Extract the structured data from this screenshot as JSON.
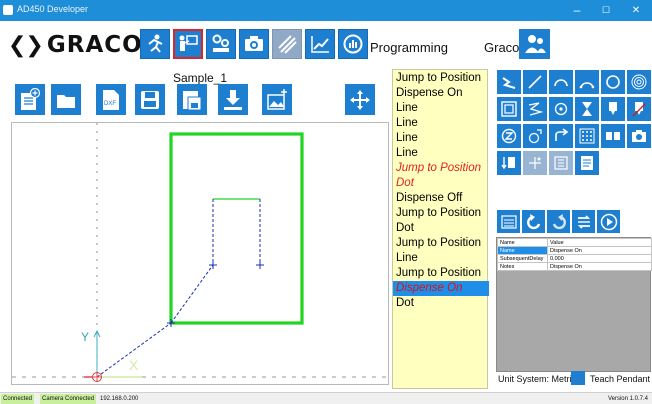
{
  "window": {
    "title": "AD450 Developer",
    "minimize": "–",
    "maximize": "☐",
    "close": "✕"
  },
  "header": {
    "logo_text": "GRACO",
    "mode": "Programming",
    "user": "Graco"
  },
  "file": {
    "name": "Sample_1",
    "dxf_label": "DXF"
  },
  "program_list": [
    {
      "label": "Jump to Position",
      "style": "normal"
    },
    {
      "label": "Dispense On",
      "style": "normal"
    },
    {
      "label": "Line",
      "style": "normal"
    },
    {
      "label": "Line",
      "style": "normal"
    },
    {
      "label": "Line",
      "style": "normal"
    },
    {
      "label": "Line",
      "style": "normal"
    },
    {
      "label": "Jump to Position",
      "style": "red"
    },
    {
      "label": "Dot",
      "style": "red"
    },
    {
      "label": "Dispense Off",
      "style": "normal"
    },
    {
      "label": "Jump to Position",
      "style": "normal"
    },
    {
      "label": "Dot",
      "style": "normal"
    },
    {
      "label": "Jump to Position",
      "style": "normal"
    },
    {
      "label": "Line",
      "style": "normal"
    },
    {
      "label": "Jump to Position",
      "style": "normal"
    },
    {
      "label": "Dispense On",
      "style": "selected"
    },
    {
      "label": "Dot",
      "style": "normal"
    }
  ],
  "properties": {
    "headers": [
      "Name",
      "Value"
    ],
    "rows": [
      {
        "name": "Name",
        "value": "Dispense On"
      },
      {
        "name": "SubsequentDelay",
        "value": "0.000"
      },
      {
        "name": "Notes",
        "value": "Dispense On"
      }
    ]
  },
  "footer": {
    "unit_system": "Unit System: Metric",
    "teach_pendant": "Teach Pendant"
  },
  "status": {
    "connected": "Connected",
    "camera": "Camera Connected",
    "ip": "192.168.0.200",
    "version": "Version 1.0.7.4"
  },
  "canvas": {
    "y_axis_label": "Y",
    "x_axis_label": "X"
  },
  "colors": {
    "accent": "#1e7fd1",
    "path_green": "#22d522",
    "path_blue": "#1a2fb0",
    "list_bg": "#ffffc0",
    "selected": "#1e8ee8"
  }
}
